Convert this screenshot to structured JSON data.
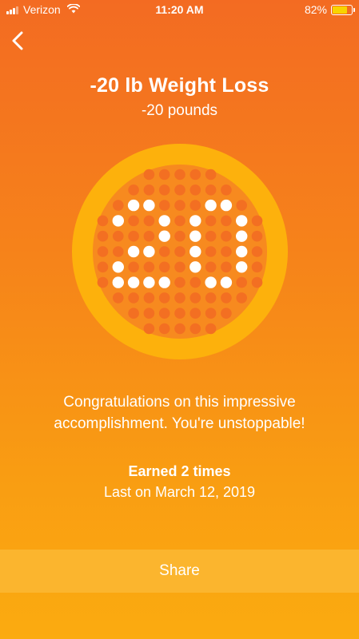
{
  "status_bar": {
    "carrier": "Verizon",
    "time": "11:20 AM",
    "battery_percent": "82%",
    "battery_level": 0.82
  },
  "header": {
    "back_icon": "chevron-left-icon"
  },
  "badge": {
    "title": "-20 lb Weight Loss",
    "subtitle": "-20 pounds",
    "icon": "dot-matrix-20-badge-icon",
    "colors": {
      "ring": "#fdb10c",
      "face": "#f78a1f",
      "dot_dim": "#f36f22",
      "dot_lit": "#ffffff"
    }
  },
  "message": "Congratulations on this impressive accomplishment. You're unstoppable!",
  "earned": "Earned 2 times",
  "last_earned": "Last on March 12, 2019",
  "share_label": "Share"
}
